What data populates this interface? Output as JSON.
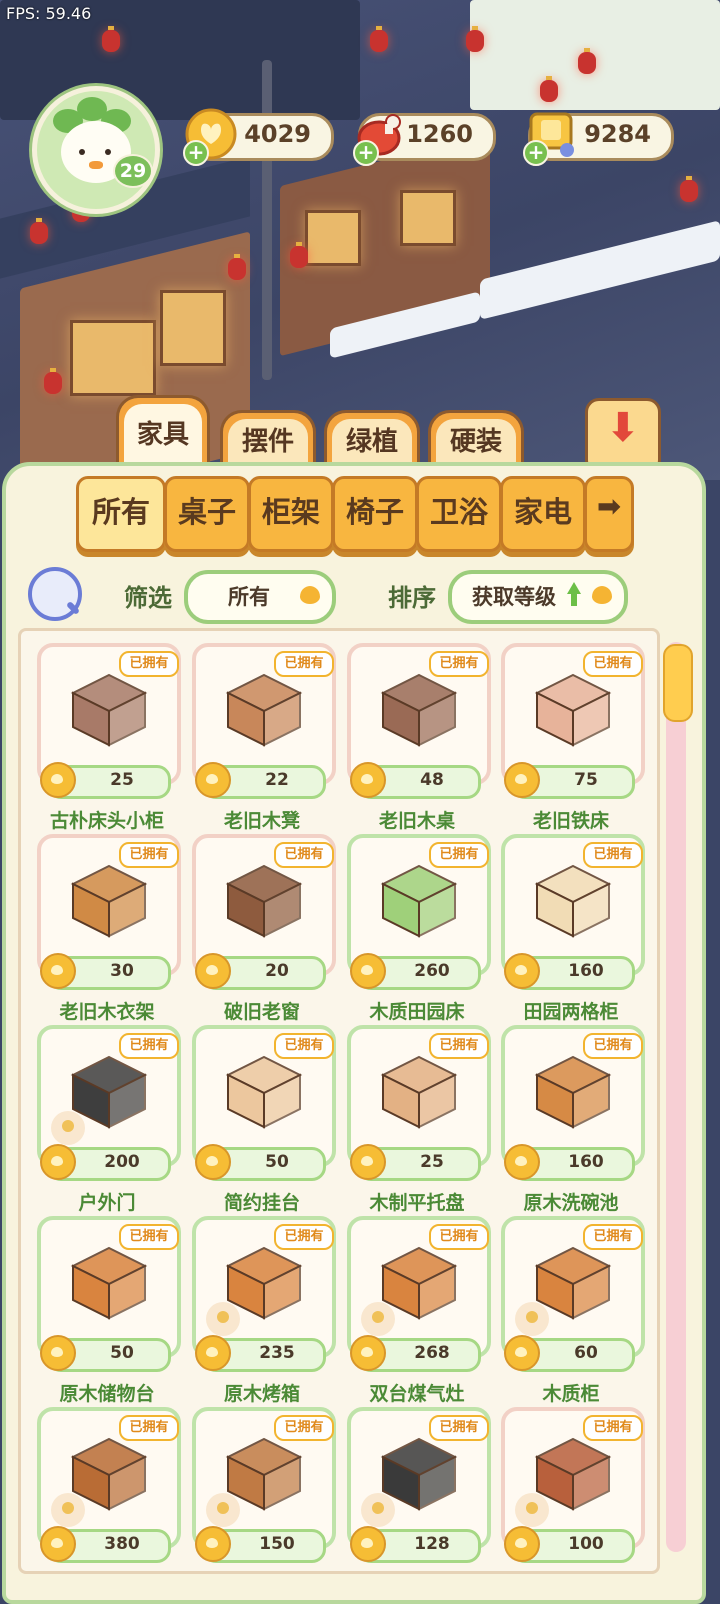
{
  "fps": "FPS: 59.46",
  "player": {
    "level": "29"
  },
  "currencies": [
    {
      "name": "gold-coin",
      "value": "4029",
      "color": "#f6bd35"
    },
    {
      "name": "meat",
      "value": "1260",
      "color": "#e34a36"
    },
    {
      "name": "ticket-cart",
      "value": "9284",
      "color": "#f7c542"
    }
  ],
  "tabs": [
    {
      "label": "家具",
      "active": true
    },
    {
      "label": "摆件",
      "active": false
    },
    {
      "label": "绿植",
      "active": false
    },
    {
      "label": "硬装",
      "active": false
    }
  ],
  "categories": [
    {
      "label": "所有",
      "active": true
    },
    {
      "label": "桌子",
      "active": false
    },
    {
      "label": "柜架",
      "active": false
    },
    {
      "label": "椅子",
      "active": false
    },
    {
      "label": "卫浴",
      "active": false
    },
    {
      "label": "家电",
      "active": false
    }
  ],
  "filter": {
    "label": "筛选",
    "value": "所有"
  },
  "sort": {
    "label": "排序",
    "value": "获取等级"
  },
  "owned_label": "已拥有",
  "items": [
    {
      "name": "古朴床头小柜",
      "price": "25",
      "icon": "cabinet-icon",
      "color": "#a87a68"
    },
    {
      "name": "老旧木凳",
      "price": "22",
      "icon": "stool-icon",
      "color": "#c8875a"
    },
    {
      "name": "老旧木桌",
      "price": "48",
      "icon": "desk-icon",
      "color": "#9a6a55"
    },
    {
      "name": "老旧铁床",
      "price": "75",
      "icon": "bed-icon",
      "color": "#e7b39a"
    },
    {
      "name": "老旧木衣架",
      "price": "30",
      "icon": "coat-rack-icon",
      "color": "#d08a45"
    },
    {
      "name": "破旧老窗",
      "price": "20",
      "icon": "window-icon",
      "color": "#8e5b3e"
    },
    {
      "name": "木质田园床",
      "price": "260",
      "icon": "bed-icon",
      "color": "#9fd07a"
    },
    {
      "name": "田园两格柜",
      "price": "160",
      "icon": "cupboard-icon",
      "color": "#f1dcb5"
    },
    {
      "name": "户外门",
      "price": "200",
      "icon": "door-icon",
      "color": "#3e3e3e"
    },
    {
      "name": "简约挂台",
      "price": "50",
      "icon": "shelf-icon",
      "color": "#ecc79e"
    },
    {
      "name": "木制平托盘",
      "price": "25",
      "icon": "tray-icon",
      "color": "#e3b184"
    },
    {
      "name": "原木洗碗池",
      "price": "160",
      "icon": "sink-icon",
      "color": "#d68a45"
    },
    {
      "name": "原木储物台",
      "price": "50",
      "icon": "counter-icon",
      "color": "#d9843f"
    },
    {
      "name": "原木烤箱",
      "price": "235",
      "icon": "oven-icon",
      "color": "#d9843f"
    },
    {
      "name": "双台煤气灶",
      "price": "268",
      "icon": "stove-icon",
      "color": "#d9843f"
    },
    {
      "name": "木质柜",
      "price": "60",
      "icon": "counter-icon",
      "color": "#d9843f"
    },
    {
      "name": "",
      "price": "380",
      "icon": "sideboard-icon",
      "color": "#b96c35"
    },
    {
      "name": "",
      "price": "150",
      "icon": "tv-stand-icon",
      "color": "#c07a44"
    },
    {
      "name": "",
      "price": "128",
      "icon": "tv-icon",
      "color": "#3a3a3a"
    },
    {
      "name": "",
      "price": "100",
      "icon": "crate-icon",
      "color": "#b8603c"
    }
  ]
}
